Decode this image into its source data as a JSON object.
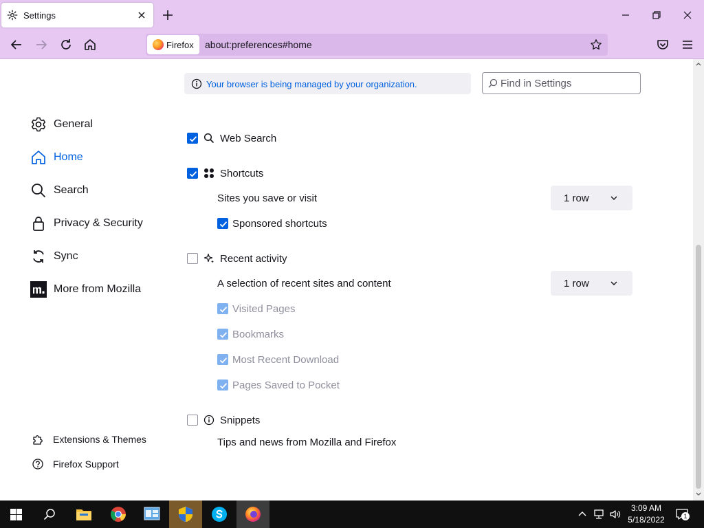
{
  "tab": {
    "title": "Settings"
  },
  "urlbar": {
    "identity_label": "Firefox",
    "url": "about:preferences#home"
  },
  "notice": {
    "managed_text": "Your browser is being managed by your organization."
  },
  "search": {
    "placeholder": "Find in Settings"
  },
  "sidebar": {
    "items": [
      {
        "label": "General",
        "icon": "gear-icon"
      },
      {
        "label": "Home",
        "icon": "home-icon",
        "active": true
      },
      {
        "label": "Search",
        "icon": "search-icon"
      },
      {
        "label": "Privacy & Security",
        "icon": "lock-icon"
      },
      {
        "label": "Sync",
        "icon": "sync-icon"
      },
      {
        "label": "More from Mozilla",
        "icon": "mozilla-icon"
      }
    ],
    "footer": [
      {
        "label": "Extensions & Themes",
        "icon": "puzzle-icon"
      },
      {
        "label": "Firefox Support",
        "icon": "help-icon"
      }
    ]
  },
  "sections": {
    "web_search": {
      "title": "Web Search",
      "checked": true
    },
    "shortcuts": {
      "title": "Shortcuts",
      "checked": true,
      "rows_label": "Sites you save or visit",
      "rows_value": "1 row",
      "sponsored_label": "Sponsored shortcuts",
      "sponsored_checked": true
    },
    "recent": {
      "title": "Recent activity",
      "checked": false,
      "rows_label": "A selection of recent sites and content",
      "rows_value": "1 row",
      "options": [
        "Visited Pages",
        "Bookmarks",
        "Most Recent Download",
        "Pages Saved to Pocket"
      ]
    },
    "snippets": {
      "title": "Snippets",
      "checked": false,
      "description": "Tips and news from Mozilla and Firefox"
    }
  },
  "taskbar": {
    "time": "3:09 AM",
    "date": "5/18/2022",
    "notification_count": "1"
  },
  "colors": {
    "chrome": "#e6c8f2",
    "accent": "#0061e0",
    "taskbar": "#101010"
  }
}
